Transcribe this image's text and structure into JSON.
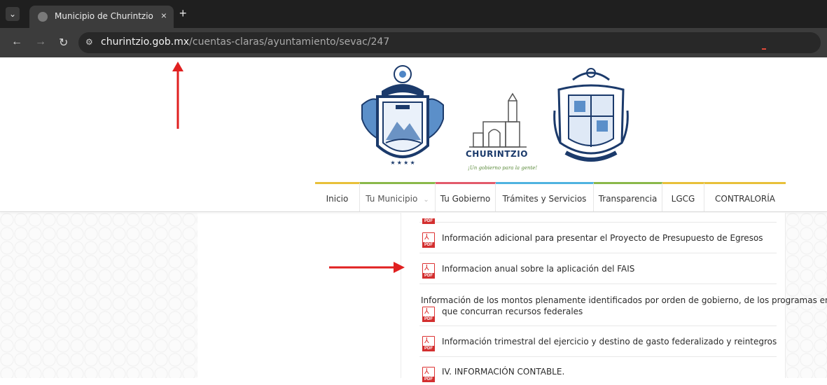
{
  "browser": {
    "tab_title": "Municipio de Churintzio",
    "tab_close": "×",
    "new_tab": "+",
    "url_domain": "churintzio.gob.mx",
    "url_path": "/cuentas-claras/ayuntamiento/sevac/247"
  },
  "header": {
    "brand_name": "CHURINTZIO",
    "brand_tagline": "¡Un gobierno para la gente!"
  },
  "nav": {
    "items": [
      {
        "label": "Inicio",
        "color": "#e8c03a"
      },
      {
        "label": "Tu Municipio",
        "color": "#8ab84a"
      },
      {
        "label": "Tu Gobierno",
        "color": "#e25a6b"
      },
      {
        "label": "Trámites y Servicios",
        "color": "#4fb3e0"
      },
      {
        "label": "Transparencia",
        "color": "#8ab84a"
      },
      {
        "label": "LGCG",
        "color": "#e8c03a"
      },
      {
        "label": "CONTRALORÍA",
        "color": "#e8c03a"
      }
    ]
  },
  "documents": [
    {
      "label": "Información adicional para presentar el Proyecto de Presupuesto de Egresos"
    },
    {
      "label": "Informacion anual sobre la aplicación del FAIS"
    },
    {
      "label_line1": "Información de los montos plenamente identificados por orden de gobierno, de los programas en",
      "label_line2": "que concurran recursos federales"
    },
    {
      "label": "Información trimestral del ejercicio y destino de gasto federalizado y reintegros"
    },
    {
      "label": "IV. INFORMACIÓN CONTABLE."
    }
  ],
  "pdf_tag": "PDF",
  "annotation_color": "#e02020"
}
